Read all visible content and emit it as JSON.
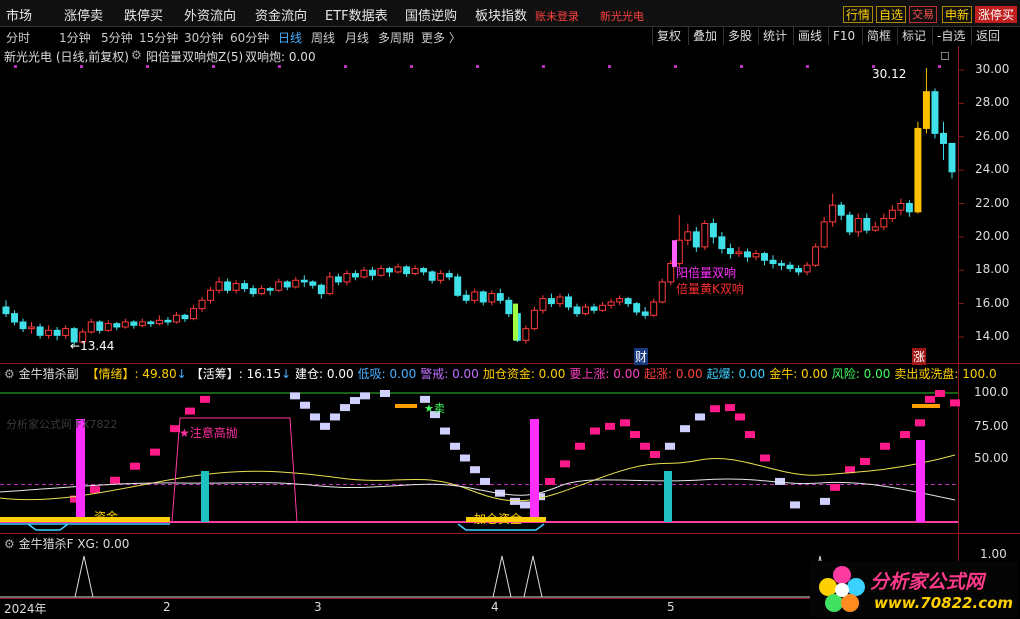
{
  "topnav": {
    "items": [
      "市场",
      "涨停卖",
      "跌停买",
      "外资流向",
      "资金流向",
      "ETF数据表",
      "国债逆购",
      "板块指数"
    ],
    "login": "账未登录",
    "stock_name": "新光光电",
    "right_buttons": [
      "行情",
      "自选",
      "交易",
      "申新",
      "涨停买"
    ]
  },
  "periods": {
    "items": [
      "分时",
      "1分钟",
      "5分钟",
      "15分钟",
      "30分钟",
      "60分钟",
      "日线",
      "周线",
      "月线",
      "多周期",
      "更多 〉"
    ],
    "selected": "日线"
  },
  "tools": [
    "复权",
    "叠加",
    "多股",
    "统计",
    "画线",
    "F10",
    "简框",
    "标记",
    "-自选",
    "返回"
  ],
  "main_pane": {
    "title": "新光光电 (日线,前复权)",
    "indicator": "阳倍量双响炮Z(5)",
    "indicator_value": "双响炮: 0.00",
    "y_ticks": [
      "30.00",
      "28.00",
      "26.00",
      "24.00",
      "22.00",
      "20.00",
      "18.00",
      "16.00",
      "14.00"
    ],
    "high_label": "30.12",
    "low_label": "13.44",
    "annot1": "阳倍量双响",
    "annot2": "倍量黄K双响",
    "mark_cai": "财",
    "mark_zhang": "涨"
  },
  "sub1": {
    "title": "金牛猎杀副",
    "fields": [
      {
        "label": "【情绪】",
        "value": ": 49.80",
        "color": "#ffd000",
        "arrow": "↓"
      },
      {
        "label": "【活筹】",
        "value": ": 16.15",
        "color": "#ffffff",
        "arrow": "↓"
      },
      {
        "label": "建仓",
        "value": ": 0.00",
        "color": "#ffffff"
      },
      {
        "label": "低吸",
        "value": ": 0.00",
        "color": "#4ab0ff"
      },
      {
        "label": "警戒",
        "value": ": 0.00",
        "color": "#c070ff"
      },
      {
        "label": "加仓资金",
        "value": ": 0.00",
        "color": "#ffd000"
      },
      {
        "label": "要上涨",
        "value": ": 0.00",
        "color": "#ff40c0"
      },
      {
        "label": "起涨",
        "value": ": 0.00",
        "color": "#ff4040"
      },
      {
        "label": "起爆",
        "value": ": 0.00",
        "color": "#40d0ff"
      },
      {
        "label": "金牛",
        "value": ": 0.00",
        "color": "#ffd000"
      },
      {
        "label": "风险",
        "value": ": 0.00",
        "color": "#40ff60"
      },
      {
        "label": "卖出或洗盘",
        "value": ": 100.0",
        "color": "#ffd000"
      }
    ],
    "y_ticks": [
      "100.0",
      "75.00",
      "50.00"
    ],
    "annot_warn": "★注意高抛",
    "annot_zijin": "资金",
    "annot_jiacang": "加仓资金",
    "annot_sell": "★卖",
    "watermark": "分析家公式网 FX7822"
  },
  "sub2": {
    "title": "金牛猎杀F",
    "value": "XG: 0.00",
    "y_ticks": [
      "1.00"
    ]
  },
  "xaxis": [
    "2024年",
    "2",
    "3",
    "4",
    "5"
  ],
  "logo": {
    "text": "分析家公式网",
    "url": "www.70822.com"
  },
  "chart_data": {
    "type": "candlestick",
    "title": "新光光电 (日线,前复权)",
    "ylim": [
      13,
      31
    ],
    "y_ticks": [
      14,
      16,
      18,
      20,
      22,
      24,
      26,
      28,
      30
    ],
    "high": 30.12,
    "low": 13.44,
    "candles": [
      [
        15.8,
        15.4,
        16.2,
        15.2
      ],
      [
        15.4,
        14.9,
        15.6,
        14.7
      ],
      [
        14.9,
        14.5,
        15.1,
        14.3
      ],
      [
        14.5,
        14.6,
        14.9,
        14.2
      ],
      [
        14.6,
        14.1,
        14.8,
        13.9
      ],
      [
        14.1,
        14.4,
        14.7,
        13.9
      ],
      [
        14.4,
        14.1,
        14.6,
        13.8
      ],
      [
        14.1,
        14.5,
        14.7,
        13.9
      ],
      [
        14.5,
        13.7,
        14.6,
        13.44
      ],
      [
        13.7,
        14.3,
        14.5,
        13.6
      ],
      [
        14.3,
        14.9,
        15.1,
        14.2
      ],
      [
        14.9,
        14.4,
        15.0,
        14.2
      ],
      [
        14.4,
        14.8,
        15.0,
        14.3
      ],
      [
        14.8,
        14.6,
        14.9,
        14.4
      ],
      [
        14.6,
        14.9,
        15.1,
        14.5
      ],
      [
        14.9,
        14.7,
        15.0,
        14.5
      ],
      [
        14.7,
        14.9,
        15.1,
        14.6
      ],
      [
        14.9,
        14.8,
        15.0,
        14.6
      ],
      [
        14.8,
        15.0,
        15.3,
        14.7
      ],
      [
        15.0,
        14.9,
        15.2,
        14.7
      ],
      [
        14.9,
        15.3,
        15.5,
        14.8
      ],
      [
        15.3,
        15.1,
        15.4,
        14.9
      ],
      [
        15.1,
        15.7,
        15.9,
        15.0
      ],
      [
        15.7,
        16.2,
        16.4,
        15.5
      ],
      [
        16.2,
        16.8,
        17.0,
        16.0
      ],
      [
        16.8,
        17.3,
        17.6,
        16.6
      ],
      [
        17.3,
        16.8,
        17.5,
        16.6
      ],
      [
        16.8,
        17.2,
        17.4,
        16.6
      ],
      [
        17.2,
        16.9,
        17.4,
        16.7
      ],
      [
        16.9,
        16.6,
        17.1,
        16.4
      ],
      [
        16.6,
        16.9,
        17.1,
        16.5
      ],
      [
        16.9,
        16.8,
        17.0,
        16.5
      ],
      [
        16.8,
        17.3,
        17.5,
        16.7
      ],
      [
        17.3,
        17.0,
        17.4,
        16.8
      ],
      [
        17.0,
        17.4,
        17.6,
        16.9
      ],
      [
        17.4,
        17.3,
        17.7,
        17.0
      ],
      [
        17.3,
        17.1,
        17.4,
        16.9
      ],
      [
        17.1,
        16.6,
        17.2,
        16.3
      ],
      [
        16.6,
        17.6,
        17.9,
        16.5
      ],
      [
        17.6,
        17.3,
        17.8,
        17.1
      ],
      [
        17.3,
        17.8,
        18.0,
        17.1
      ],
      [
        17.8,
        17.6,
        18.0,
        17.4
      ],
      [
        17.6,
        18.0,
        18.2,
        17.5
      ],
      [
        18.0,
        17.7,
        18.2,
        17.4
      ],
      [
        17.7,
        18.1,
        18.3,
        17.6
      ],
      [
        18.1,
        17.9,
        18.2,
        17.6
      ],
      [
        17.9,
        18.2,
        18.4,
        17.8
      ],
      [
        18.2,
        17.8,
        18.3,
        17.6
      ],
      [
        17.8,
        18.1,
        18.3,
        17.7
      ],
      [
        18.1,
        17.9,
        18.2,
        17.7
      ],
      [
        17.9,
        17.4,
        18.0,
        17.2
      ],
      [
        17.4,
        17.8,
        18.0,
        17.2
      ],
      [
        17.8,
        17.6,
        18.0,
        17.4
      ],
      [
        17.6,
        16.5,
        17.8,
        16.4
      ],
      [
        16.5,
        16.2,
        16.8,
        16.0
      ],
      [
        16.2,
        16.7,
        16.9,
        16.0
      ],
      [
        16.7,
        16.1,
        16.8,
        15.9
      ],
      [
        16.1,
        16.6,
        16.8,
        15.9
      ],
      [
        16.6,
        16.2,
        16.9,
        16.0
      ],
      [
        16.2,
        15.4,
        16.4,
        15.2
      ],
      [
        15.4,
        13.8,
        15.6,
        13.7
      ],
      [
        13.8,
        14.5,
        14.7,
        13.6
      ],
      [
        14.5,
        15.6,
        15.8,
        14.4
      ],
      [
        15.6,
        16.3,
        16.5,
        15.4
      ],
      [
        16.3,
        16.0,
        16.6,
        15.8
      ],
      [
        16.0,
        16.4,
        16.6,
        15.8
      ],
      [
        16.4,
        15.8,
        16.6,
        15.6
      ],
      [
        15.8,
        15.4,
        16.0,
        15.2
      ],
      [
        15.4,
        15.8,
        16.0,
        15.3
      ],
      [
        15.8,
        15.6,
        16.0,
        15.4
      ],
      [
        15.6,
        15.9,
        16.1,
        15.5
      ],
      [
        15.9,
        16.1,
        16.3,
        15.7
      ],
      [
        16.1,
        16.3,
        16.5,
        15.9
      ],
      [
        16.3,
        16.0,
        16.4,
        15.8
      ],
      [
        16.0,
        15.5,
        16.1,
        15.3
      ],
      [
        15.5,
        15.3,
        15.8,
        15.1
      ],
      [
        15.3,
        16.1,
        16.3,
        15.2
      ],
      [
        16.1,
        17.3,
        17.5,
        16.0
      ],
      [
        17.3,
        18.4,
        18.6,
        17.1
      ],
      [
        18.4,
        19.8,
        21.3,
        18.2
      ],
      [
        19.8,
        20.3,
        20.8,
        19.5
      ],
      [
        20.3,
        19.4,
        20.6,
        19.1
      ],
      [
        19.4,
        20.8,
        21.0,
        19.2
      ],
      [
        20.8,
        20.0,
        21.1,
        19.6
      ],
      [
        20.0,
        19.3,
        20.3,
        19.0
      ],
      [
        19.3,
        19.0,
        19.6,
        18.7
      ],
      [
        19.0,
        19.1,
        19.4,
        18.8
      ],
      [
        19.1,
        18.8,
        19.3,
        18.5
      ],
      [
        18.8,
        19.0,
        19.2,
        18.6
      ],
      [
        19.0,
        18.6,
        19.1,
        18.3
      ],
      [
        18.6,
        18.4,
        18.9,
        18.1
      ],
      [
        18.4,
        18.3,
        18.6,
        18.0
      ],
      [
        18.3,
        18.1,
        18.5,
        17.9
      ],
      [
        18.1,
        17.9,
        18.3,
        17.7
      ],
      [
        17.9,
        18.3,
        18.5,
        17.7
      ],
      [
        18.3,
        19.4,
        19.6,
        18.2
      ],
      [
        19.4,
        20.9,
        21.2,
        19.3
      ],
      [
        20.9,
        21.9,
        22.6,
        20.6
      ],
      [
        21.9,
        21.3,
        22.1,
        21.0
      ],
      [
        21.3,
        20.3,
        21.5,
        20.1
      ],
      [
        20.3,
        21.1,
        21.4,
        20.0
      ],
      [
        21.1,
        20.4,
        21.4,
        20.2
      ],
      [
        20.4,
        20.6,
        20.9,
        20.3
      ],
      [
        20.6,
        21.1,
        21.4,
        20.4
      ],
      [
        21.1,
        21.6,
        21.9,
        20.9
      ],
      [
        21.6,
        22.0,
        22.3,
        21.3
      ],
      [
        22.0,
        21.5,
        22.2,
        21.2
      ],
      [
        21.5,
        26.5,
        26.9,
        21.4
      ],
      [
        26.5,
        28.7,
        30.12,
        26.2
      ],
      [
        28.7,
        26.2,
        28.9,
        25.9
      ],
      [
        26.2,
        25.6,
        26.9,
        24.6
      ],
      [
        25.6,
        23.9,
        24.4,
        23.5
      ]
    ]
  }
}
